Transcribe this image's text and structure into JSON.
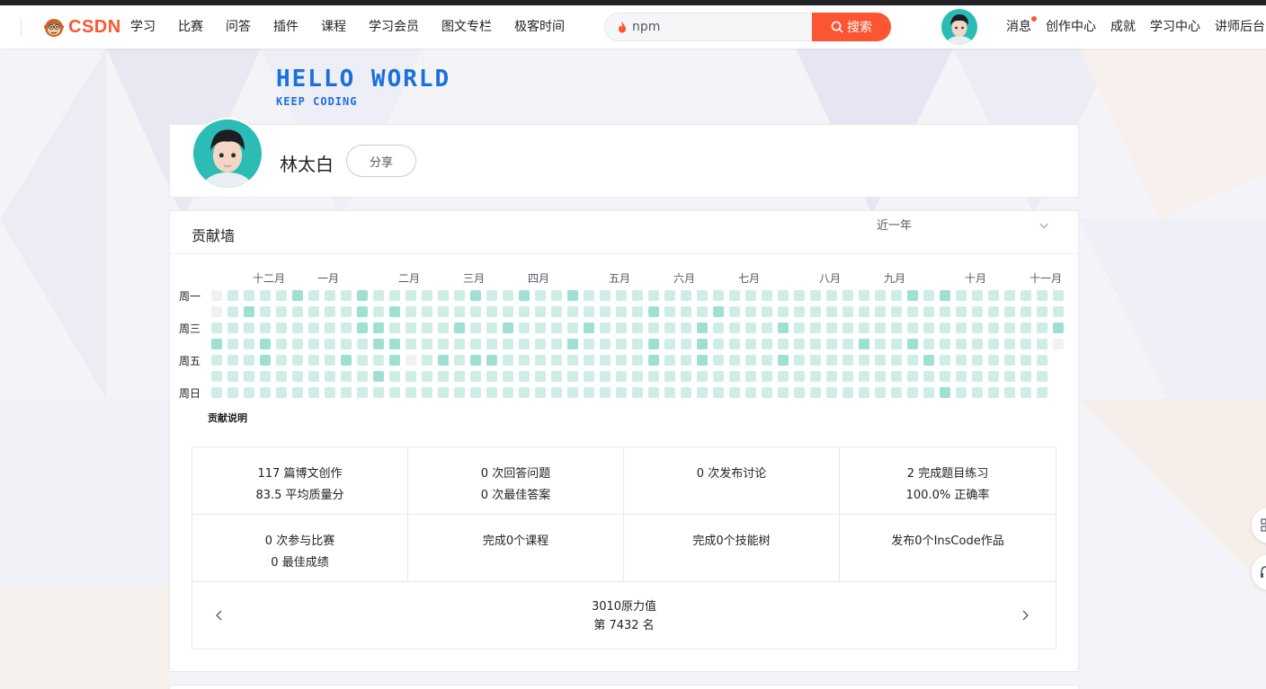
{
  "header": {
    "logo_text": "CSDN",
    "nav": [
      "学习",
      "比赛",
      "问答",
      "插件",
      "课程",
      "学习会员",
      "图文专栏",
      "极客时间"
    ],
    "search_value": "npm",
    "search_button": "搜索",
    "right_links": {
      "messages": "消息",
      "creator": "创作中心",
      "achievement": "成就",
      "learning": "学习中心",
      "teacher": "讲师后台"
    }
  },
  "banner": {
    "title": "HELLO WORLD",
    "subtitle": "KEEP CODING"
  },
  "profile": {
    "username": "林太白",
    "share_label": "分享"
  },
  "contribution": {
    "title": "贡献墙",
    "range": "近一年",
    "months": [
      "十二月",
      "一月",
      "二月",
      "三月",
      "四月",
      "五月",
      "六月",
      "七月",
      "八月",
      "九月",
      "十月",
      "十一月"
    ],
    "days": [
      "周一",
      "周三",
      "周五",
      "周日"
    ],
    "legend_label": "贡献说明"
  },
  "stats": {
    "row1": [
      [
        "117 篇博文创作",
        "83.5 平均质量分"
      ],
      [
        "0 次回答问题",
        "0 次最佳答案"
      ],
      [
        "0 次发布讨论"
      ],
      [
        "2 完成题目练习",
        "100.0% 正确率"
      ]
    ],
    "row2": [
      [
        "0 次参与比赛",
        "0 最佳成绩"
      ],
      [
        "完成0个课程"
      ],
      [
        "完成0个技能树"
      ],
      [
        "发布0个InsCode作品"
      ]
    ],
    "power_value": "3010原力值",
    "rank": "第 7432 名"
  },
  "colors": {
    "brand": "#fc5531",
    "banner_blue": "#1a6fe0",
    "cell_light": "#cdeee7",
    "cell_dark": "#9ee0d2",
    "cell_empty": "#f1f1f3"
  }
}
